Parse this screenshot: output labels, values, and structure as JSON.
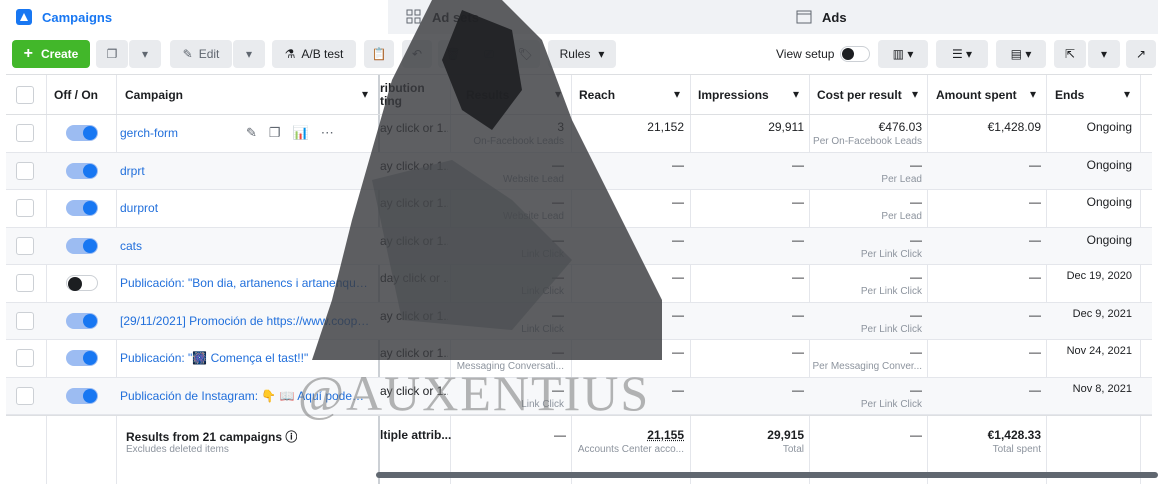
{
  "tabs": {
    "campaigns": "Campaigns",
    "adsets": "Ad sets",
    "ads": "Ads"
  },
  "toolbar": {
    "create": "Create",
    "edit": "Edit",
    "abtest": "A/B test",
    "rules": "Rules",
    "view_setup": "View setup"
  },
  "columns": {
    "onoff": "Off / On",
    "campaign": "Campaign",
    "attribution": "ribution\nting",
    "results": "Results",
    "reach": "Reach",
    "impressions": "Impressions",
    "cpr": "Cost per result",
    "spent": "Amount spent",
    "ends": "Ends"
  },
  "rows": [
    {
      "on": true,
      "name": "gerch-form",
      "attr": "ay click or 1...",
      "results": "3",
      "results_sub": "On-Facebook Leads",
      "reach": "21,152",
      "impr": "29,911",
      "cpr": "€476.03",
      "cpr_sub": "Per On-Facebook Leads",
      "spent": "€1,428.09",
      "ends": "Ongoing"
    },
    {
      "on": true,
      "name": "drprt",
      "attr": "ay click or 1...",
      "results": "—",
      "results_sub": "Website Lead",
      "reach": "—",
      "impr": "—",
      "cpr": "—",
      "cpr_sub": "Per Lead",
      "spent": "—",
      "ends": "Ongoing"
    },
    {
      "on": true,
      "name": "durprot",
      "attr": "ay click or 1...",
      "results": "—",
      "results_sub": "Website Lead",
      "reach": "—",
      "impr": "—",
      "cpr": "—",
      "cpr_sub": "Per Lead",
      "spent": "—",
      "ends": "Ongoing"
    },
    {
      "on": true,
      "name": "cats",
      "attr": "ay click or 1...",
      "results": "—",
      "results_sub": "Link Click",
      "reach": "—",
      "impr": "—",
      "cpr": "—",
      "cpr_sub": "Per Link Click",
      "spent": "—",
      "ends": "Ongoing"
    },
    {
      "on": false,
      "name": "Publicación: \"Bon dia, artanencs i artanenques! ...",
      "attr": "day click or ...",
      "results": "—",
      "results_sub": "Link Click",
      "reach": "—",
      "impr": "—",
      "cpr": "—",
      "cpr_sub": "Per Link Click",
      "spent": "—",
      "ends": "Dec 19, 2020"
    },
    {
      "on": true,
      "name": "[29/11/2021] Promoción de https://www.cooper...",
      "attr": "ay click or 1...",
      "results": "—",
      "results_sub": "Link Click",
      "reach": "—",
      "impr": "—",
      "cpr": "—",
      "cpr_sub": "Per Link Click",
      "spent": "—",
      "ends": "Dec 9, 2021"
    },
    {
      "on": true,
      "name": "Publicación: \"🎆 Comença el tast!!\"",
      "attr": "ay click or 1...",
      "results": "—",
      "results_sub": "Messaging Conversati...",
      "reach": "—",
      "impr": "—",
      "cpr": "—",
      "cpr_sub": "Per Messaging Conver...",
      "spent": "—",
      "ends": "Nov 24, 2021"
    },
    {
      "on": true,
      "name": "Publicación de Instagram: 👇 📖 Aquí podeu tro...",
      "attr": "ay click or 1...",
      "results": "—",
      "results_sub": "Link Click",
      "reach": "—",
      "impr": "—",
      "cpr": "—",
      "cpr_sub": "Per Link Click",
      "spent": "—",
      "ends": "Nov 8, 2021"
    }
  ],
  "summary": {
    "title": "Results from 21 campaigns",
    "sub": "Excludes deleted items",
    "attr": "ltiple attrib...",
    "results": "—",
    "reach": "21,155",
    "reach_sub": "Accounts Center acco...",
    "impr": "29,915",
    "impr_sub": "Total",
    "cpr": "—",
    "spent": "€1,428.33",
    "spent_sub": "Total spent"
  },
  "watermark": "@AUXENTIUS",
  "colors": {
    "accent": "#1877f2",
    "create_green": "#42b72a"
  }
}
